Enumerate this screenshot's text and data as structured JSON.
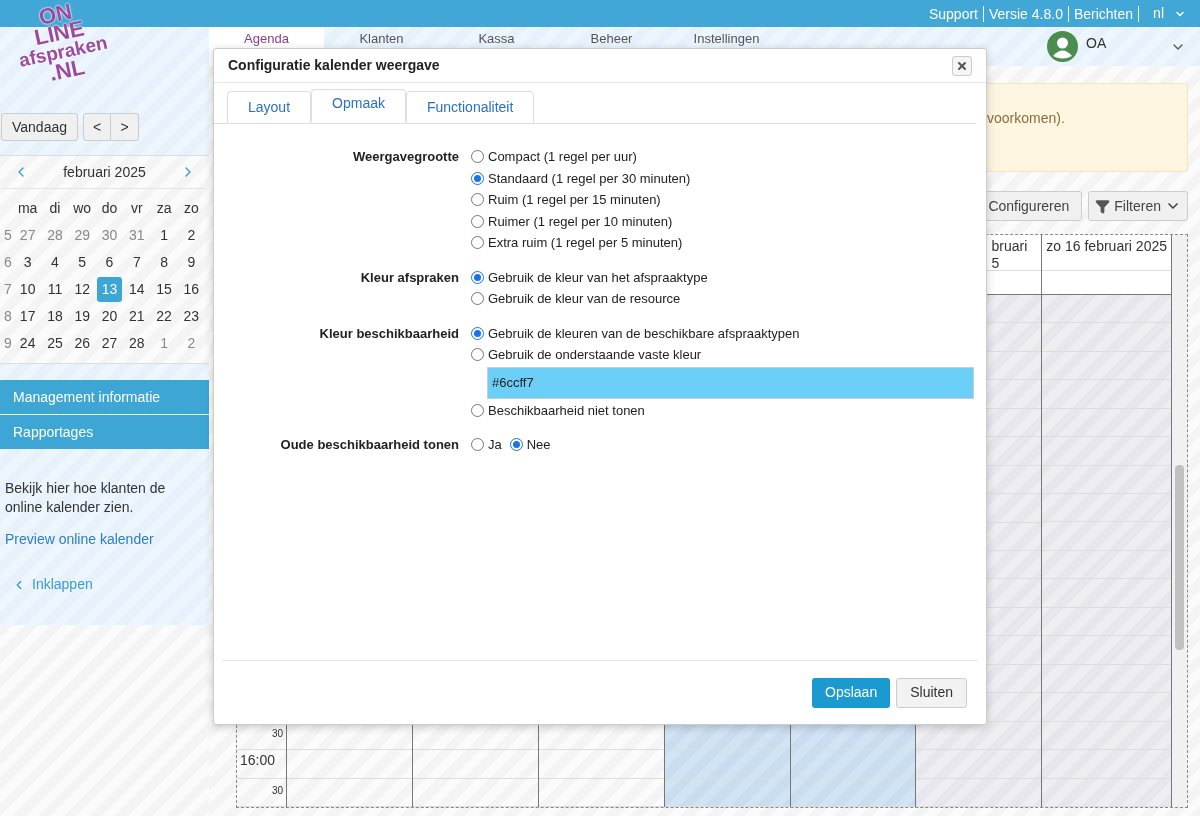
{
  "top_bar": {
    "links": [
      "Support",
      "Versie 4.8.0",
      "Berichten"
    ],
    "language": "nl"
  },
  "logo": {
    "lines": [
      "ON",
      "LINE",
      "afspraken",
      ".NL"
    ]
  },
  "nav": {
    "tabs": [
      {
        "label": "Agenda",
        "selected": true
      },
      {
        "label": "Klanten",
        "selected": false
      },
      {
        "label": "Kassa",
        "selected": false
      },
      {
        "label": "Beheer",
        "selected": false
      },
      {
        "label": "Instellingen",
        "selected": false
      }
    ],
    "user": "OA"
  },
  "sidebar": {
    "today_button": "Vandaag",
    "prev_button": "<",
    "next_button": ">",
    "mini_calendar": {
      "month": "februari 2025",
      "weekdays": [
        "ma",
        "di",
        "wo",
        "do",
        "vr",
        "za",
        "zo"
      ],
      "weeks": [
        {
          "number": "5",
          "days": [
            {
              "day": "27",
              "outside": true,
              "selected": false
            },
            {
              "day": "28",
              "outside": true,
              "selected": false
            },
            {
              "day": "29",
              "outside": true,
              "selected": false
            },
            {
              "day": "30",
              "outside": true,
              "selected": false
            },
            {
              "day": "31",
              "outside": true,
              "selected": false
            },
            {
              "day": "1",
              "outside": false,
              "selected": false
            },
            {
              "day": "2",
              "outside": false,
              "selected": false
            }
          ]
        },
        {
          "number": "6",
          "days": [
            {
              "day": "3",
              "outside": false,
              "selected": false
            },
            {
              "day": "4",
              "outside": false,
              "selected": false
            },
            {
              "day": "5",
              "outside": false,
              "selected": false
            },
            {
              "day": "6",
              "outside": false,
              "selected": false
            },
            {
              "day": "7",
              "outside": false,
              "selected": false
            },
            {
              "day": "8",
              "outside": false,
              "selected": false
            },
            {
              "day": "9",
              "outside": false,
              "selected": false
            }
          ]
        },
        {
          "number": "7",
          "days": [
            {
              "day": "10",
              "outside": false,
              "selected": false
            },
            {
              "day": "11",
              "outside": false,
              "selected": false
            },
            {
              "day": "12",
              "outside": false,
              "selected": false
            },
            {
              "day": "13",
              "outside": false,
              "selected": true
            },
            {
              "day": "14",
              "outside": false,
              "selected": false
            },
            {
              "day": "15",
              "outside": false,
              "selected": false
            },
            {
              "day": "16",
              "outside": false,
              "selected": false
            }
          ]
        },
        {
          "number": "8",
          "days": [
            {
              "day": "17",
              "outside": false,
              "selected": false
            },
            {
              "day": "18",
              "outside": false,
              "selected": false
            },
            {
              "day": "19",
              "outside": false,
              "selected": false
            },
            {
              "day": "20",
              "outside": false,
              "selected": false
            },
            {
              "day": "21",
              "outside": false,
              "selected": false
            },
            {
              "day": "22",
              "outside": false,
              "selected": false
            },
            {
              "day": "23",
              "outside": false,
              "selected": false
            }
          ]
        },
        {
          "number": "9",
          "days": [
            {
              "day": "24",
              "outside": false,
              "selected": false
            },
            {
              "day": "25",
              "outside": false,
              "selected": false
            },
            {
              "day": "26",
              "outside": false,
              "selected": false
            },
            {
              "day": "27",
              "outside": false,
              "selected": false
            },
            {
              "day": "28",
              "outside": false,
              "selected": false
            },
            {
              "day": "1",
              "outside": true,
              "selected": false
            },
            {
              "day": "2",
              "outside": true,
              "selected": false
            }
          ]
        }
      ]
    },
    "menu": [
      "Management informatie",
      "Rapportages"
    ],
    "info_text": "Bekijk hier hoe klanten de online kalender zien.",
    "preview_link": "Preview online kalender",
    "collapse_link": "Inklappen"
  },
  "main": {
    "notice": "voorkomen).",
    "configure_button": "Configureren",
    "filter_button": "Filteren",
    "calendar": {
      "columns": [
        {
          "kind": "plain"
        },
        {
          "kind": "plain"
        },
        {
          "kind": "plain"
        },
        {
          "kind": "available"
        },
        {
          "kind": "available"
        },
        {
          "kind": "closed",
          "header": [
            "bruari",
            "5"
          ]
        },
        {
          "kind": "closed",
          "header": [
            "zo 16 februari 2025"
          ]
        }
      ],
      "time_rows": [
        {
          "kind": "half",
          "label": "30"
        },
        {
          "kind": "hour",
          "label": "16:00"
        },
        {
          "kind": "half",
          "label": "30"
        }
      ]
    }
  },
  "dialog": {
    "title": "Configuratie kalender weergave",
    "tabs": [
      {
        "label": "Layout",
        "selected": false
      },
      {
        "label": "Opmaak",
        "selected": true
      },
      {
        "label": "Functionaliteit",
        "selected": false
      }
    ],
    "groups": [
      {
        "label": "Weergavegrootte",
        "inline": false,
        "options": [
          {
            "kind": "radio",
            "label": "Compact (1 regel per uur)",
            "selected": false
          },
          {
            "kind": "radio",
            "label": "Standaard (1 regel per 30 minuten)",
            "selected": true
          },
          {
            "kind": "radio",
            "label": "Ruim (1 regel per 15 minuten)",
            "selected": false
          },
          {
            "kind": "radio",
            "label": "Ruimer (1 regel per 10 minuten)",
            "selected": false
          },
          {
            "kind": "radio",
            "label": "Extra ruim (1 regel per 5 minuten)",
            "selected": false
          }
        ]
      },
      {
        "label": "Kleur afspraken",
        "inline": false,
        "options": [
          {
            "kind": "radio",
            "label": "Gebruik de kleur van het afspraaktype",
            "selected": true
          },
          {
            "kind": "radio",
            "label": "Gebruik de kleur van de resource",
            "selected": false
          }
        ]
      },
      {
        "label": "Kleur beschikbaarheid",
        "inline": false,
        "options": [
          {
            "kind": "radio",
            "label": "Gebruik de kleuren van de beschikbare afspraaktypen",
            "selected": true
          },
          {
            "kind": "radio",
            "label": "Gebruik de onderstaande vaste kleur",
            "selected": false
          },
          {
            "kind": "color_field",
            "value": "#6ccff7",
            "color": "#6ccff7"
          },
          {
            "kind": "radio",
            "label": "Beschikbaarheid niet tonen",
            "selected": false
          }
        ]
      },
      {
        "label": "Oude beschikbaarheid tonen",
        "inline": true,
        "options": [
          {
            "kind": "radio",
            "label": "Ja",
            "selected": false
          },
          {
            "kind": "radio",
            "label": "Nee",
            "selected": true
          }
        ]
      }
    ],
    "save_button": "Opslaan",
    "close_button": "Sluiten"
  }
}
